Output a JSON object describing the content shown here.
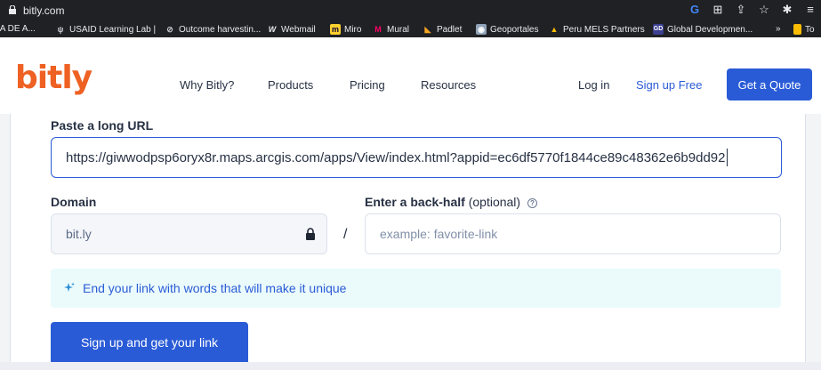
{
  "browser": {
    "url": "bitly.com",
    "bookmarks": [
      {
        "label": "IA DE A...",
        "icon": "folder-icon"
      },
      {
        "label": "USAID Learning Lab |",
        "icon": "usaid-icon"
      },
      {
        "label": "Outcome harvestin...",
        "icon": "outcome-icon"
      },
      {
        "label": "Webmail",
        "icon": "webmail-icon"
      },
      {
        "label": "Miro",
        "icon": "miro-icon"
      },
      {
        "label": "Mural",
        "icon": "mural-icon"
      },
      {
        "label": "Padlet",
        "icon": "padlet-icon"
      },
      {
        "label": "Geoportales",
        "icon": "geoportales-icon"
      },
      {
        "label": "Peru MELS Partners",
        "icon": "drive-icon"
      },
      {
        "label": "Global Developmen...",
        "icon": "global-dev-icon"
      },
      {
        "label": "To",
        "icon": "folder-icon"
      }
    ],
    "more_label": "»"
  },
  "header": {
    "logo": "bitly",
    "nav": [
      "Why Bitly?",
      "Products",
      "Pricing",
      "Resources"
    ],
    "login": "Log in",
    "signup": "Sign up Free",
    "quote": "Get a Quote"
  },
  "form": {
    "long_url_label": "Paste a long URL",
    "long_url_value": "https://giwwodpsp6oryx8r.maps.arcgis.com/apps/View/index.html?appid=ec6df5770f1844ce89c48362e6b9dd92",
    "domain_label": "Domain",
    "domain_value": "bit.ly",
    "backhalf_label": "Enter a back-half",
    "backhalf_optional": "(optional)",
    "backhalf_placeholder": "example: favorite-link",
    "separator": "/",
    "tip": "End your link with words that will make it unique",
    "submit": "Sign up and get your link"
  },
  "colors": {
    "brand": "#ee6123",
    "accent": "#2a5bd7",
    "tip_bg": "#ebfbfb"
  }
}
